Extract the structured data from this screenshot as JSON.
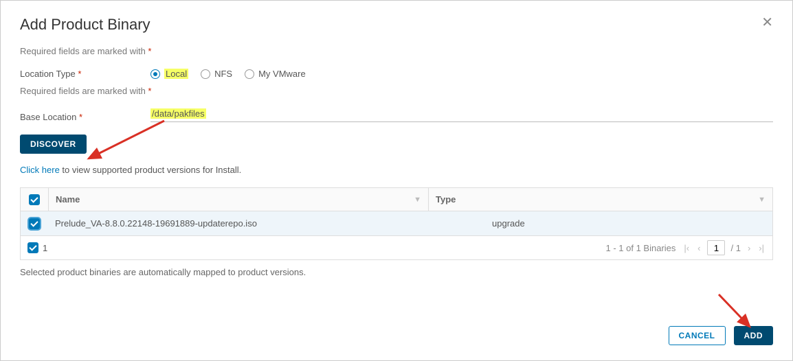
{
  "title": "Add Product Binary",
  "required_hint_prefix": "Required fields are marked with ",
  "required_hint_star": "*",
  "location_type_label": "Location Type ",
  "radios": {
    "local": "Local",
    "nfs": "NFS",
    "myvmware": "My VMware"
  },
  "base_location_label": "Base Location ",
  "base_location_value": "/data/pakfiles",
  "discover_label": "DISCOVER",
  "support_link": "Click here",
  "support_rest": " to view supported product versions for Install.",
  "table": {
    "col_name": "Name",
    "col_type": "Type",
    "rows": [
      {
        "name": "Prelude_VA-8.8.0.22148-19691889-updaterepo.iso",
        "type": "upgrade"
      }
    ],
    "selected_count": "1",
    "range_text": "1 - 1 of 1 Binaries",
    "page_current": "1",
    "page_total": "/ 1"
  },
  "footnote": "Selected product binaries are automatically mapped to product versions.",
  "actions": {
    "cancel": "CANCEL",
    "add": "ADD"
  }
}
